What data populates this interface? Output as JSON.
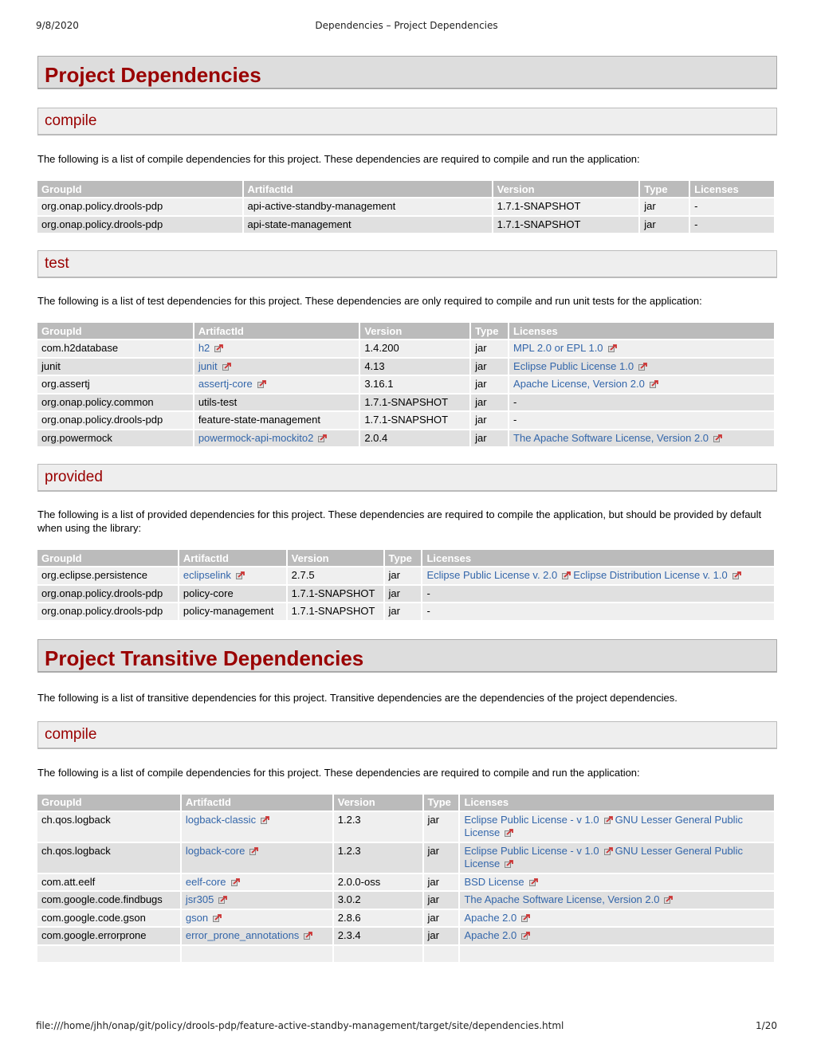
{
  "print_header": {
    "date": "9/8/2020",
    "title": "Dependencies – Project Dependencies"
  },
  "print_footer": {
    "url": "file:///home/jhh/onap/git/policy/drools-pdp/feature-active-standby-management/target/site/dependencies.html",
    "page": "1/20"
  },
  "columns": [
    "GroupId",
    "ArtifactId",
    "Version",
    "Type",
    "Licenses"
  ],
  "project": {
    "title": "Project Dependencies",
    "compile": {
      "title": "compile",
      "description": "The following is a list of compile dependencies for this project. These dependencies are required to compile and run the application:",
      "rows": [
        {
          "group": "org.onap.policy.drools-pdp",
          "artifact": "api-active-standby-management",
          "artifact_link": false,
          "version": "1.7.1-SNAPSHOT",
          "type": "jar",
          "licenses": []
        },
        {
          "group": "org.onap.policy.drools-pdp",
          "artifact": "api-state-management",
          "artifact_link": false,
          "version": "1.7.1-SNAPSHOT",
          "type": "jar",
          "licenses": []
        }
      ]
    },
    "test": {
      "title": "test",
      "description": "The following is a list of test dependencies for this project. These dependencies are only required to compile and run unit tests for the application:",
      "rows": [
        {
          "group": "com.h2database",
          "artifact": "h2",
          "artifact_link": true,
          "version": "1.4.200",
          "type": "jar",
          "licenses": [
            "MPL 2.0 or EPL 1.0"
          ]
        },
        {
          "group": "junit",
          "artifact": "junit",
          "artifact_link": true,
          "version": "4.13",
          "type": "jar",
          "licenses": [
            "Eclipse Public License 1.0"
          ]
        },
        {
          "group": "org.assertj",
          "artifact": "assertj-core",
          "artifact_link": true,
          "version": "3.16.1",
          "type": "jar",
          "licenses": [
            "Apache License, Version 2.0"
          ]
        },
        {
          "group": "org.onap.policy.common",
          "artifact": "utils-test",
          "artifact_link": false,
          "version": "1.7.1-SNAPSHOT",
          "type": "jar",
          "licenses": []
        },
        {
          "group": "org.onap.policy.drools-pdp",
          "artifact": "feature-state-management",
          "artifact_link": false,
          "version": "1.7.1-SNAPSHOT",
          "type": "jar",
          "licenses": []
        },
        {
          "group": "org.powermock",
          "artifact": "powermock-api-mockito2",
          "artifact_link": true,
          "version": "2.0.4",
          "type": "jar",
          "licenses": [
            "The Apache Software License, Version 2.0"
          ]
        }
      ]
    },
    "provided": {
      "title": "provided",
      "description": "The following is a list of provided dependencies for this project. These dependencies are required to compile the application, but should be provided by default when using the library:",
      "rows": [
        {
          "group": "org.eclipse.persistence",
          "artifact": "eclipselink",
          "artifact_link": true,
          "version": "2.7.5",
          "type": "jar",
          "licenses": [
            "Eclipse Public License v. 2.0",
            "Eclipse Distribution License v. 1.0"
          ]
        },
        {
          "group": "org.onap.policy.drools-pdp",
          "artifact": "policy-core",
          "artifact_link": false,
          "version": "1.7.1-SNAPSHOT",
          "type": "jar",
          "licenses": []
        },
        {
          "group": "org.onap.policy.drools-pdp",
          "artifact": "policy-management",
          "artifact_link": false,
          "version": "1.7.1-SNAPSHOT",
          "type": "jar",
          "licenses": []
        }
      ]
    }
  },
  "transitive": {
    "title": "Project Transitive Dependencies",
    "description": "The following is a list of transitive dependencies for this project. Transitive dependencies are the dependencies of the project dependencies.",
    "compile": {
      "title": "compile",
      "description": "The following is a list of compile dependencies for this project. These dependencies are required to compile and run the application:",
      "rows": [
        {
          "group": "ch.qos.logback",
          "artifact": "logback-classic",
          "artifact_link": true,
          "version": "1.2.3",
          "type": "jar",
          "licenses": [
            "Eclipse Public License - v 1.0",
            "GNU Lesser General Public License"
          ]
        },
        {
          "group": "ch.qos.logback",
          "artifact": "logback-core",
          "artifact_link": true,
          "version": "1.2.3",
          "type": "jar",
          "licenses": [
            "Eclipse Public License - v 1.0",
            "GNU Lesser General Public License"
          ]
        },
        {
          "group": "com.att.eelf",
          "artifact": "eelf-core",
          "artifact_link": true,
          "version": "2.0.0-oss",
          "type": "jar",
          "licenses": [
            "BSD License"
          ]
        },
        {
          "group": "com.google.code.findbugs",
          "artifact": "jsr305",
          "artifact_link": true,
          "version": "3.0.2",
          "type": "jar",
          "licenses": [
            "The Apache Software License, Version 2.0"
          ]
        },
        {
          "group": "com.google.code.gson",
          "artifact": "gson",
          "artifact_link": true,
          "version": "2.8.6",
          "type": "jar",
          "licenses": [
            "Apache 2.0"
          ]
        },
        {
          "group": "com.google.errorprone",
          "artifact": "error_prone_annotations",
          "artifact_link": true,
          "version": "2.3.4",
          "type": "jar",
          "licenses": [
            "Apache 2.0"
          ]
        },
        {
          "group": "",
          "artifact": "",
          "artifact_link": false,
          "version": "",
          "type": "",
          "licenses": [],
          "truncated": true
        }
      ]
    }
  },
  "empty_license_text": "-",
  "colors": {
    "heading": "#990000",
    "link": "#3366aa",
    "table_header": "#bbbbbb"
  }
}
